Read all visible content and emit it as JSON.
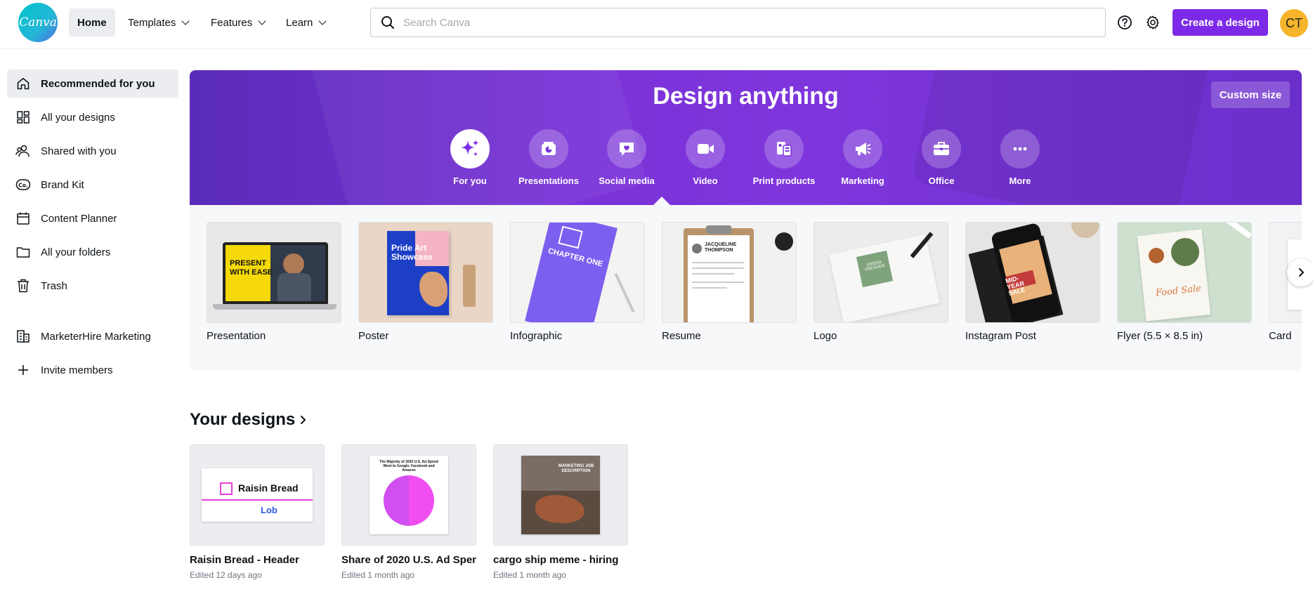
{
  "app": {
    "logo_text": "Canva",
    "avatar_initials": "CT",
    "accent_color": "#7d2ae8"
  },
  "topnav": {
    "items": [
      {
        "label": "Home"
      },
      {
        "label": "Templates"
      },
      {
        "label": "Features"
      },
      {
        "label": "Learn"
      }
    ],
    "search_placeholder": "Search Canva",
    "create_label": "Create a design"
  },
  "sidebar": {
    "items": [
      {
        "label": "Recommended for you",
        "icon": "home-icon"
      },
      {
        "label": "All your designs",
        "icon": "grid-icon"
      },
      {
        "label": "Shared with you",
        "icon": "people-icon"
      },
      {
        "label": "Brand Kit",
        "icon": "brand-kit-icon"
      },
      {
        "label": "Content Planner",
        "icon": "calendar-icon"
      },
      {
        "label": "All your folders",
        "icon": "folder-icon"
      },
      {
        "label": "Trash",
        "icon": "trash-icon"
      }
    ],
    "team": {
      "label": "MarketerHire Marketing",
      "icon": "building-icon"
    },
    "invite": {
      "label": "Invite members",
      "icon": "plus-icon"
    }
  },
  "hero": {
    "title": "Design anything",
    "custom_size_label": "Custom size",
    "categories": [
      {
        "label": "For you",
        "icon": "sparkle-icon"
      },
      {
        "label": "Presentations",
        "icon": "presentation-icon"
      },
      {
        "label": "Social media",
        "icon": "heart-chat-icon"
      },
      {
        "label": "Video",
        "icon": "video-icon"
      },
      {
        "label": "Print products",
        "icon": "print-icon"
      },
      {
        "label": "Marketing",
        "icon": "megaphone-icon"
      },
      {
        "label": "Office",
        "icon": "briefcase-icon"
      },
      {
        "label": "More",
        "icon": "more-icon"
      }
    ]
  },
  "templates": [
    {
      "label": "Presentation",
      "thumb_text": "PRESENT WITH EASE"
    },
    {
      "label": "Poster",
      "thumb_text": "Pride Art Showcase"
    },
    {
      "label": "Infographic",
      "thumb_text": "CHAPTER ONE"
    },
    {
      "label": "Resume",
      "thumb_text": "JACQUELINE THOMPSON"
    },
    {
      "label": "Logo",
      "thumb_text": "GREEN FRESHER"
    },
    {
      "label": "Instagram Post",
      "thumb_text": "MID-YEAR SALE"
    },
    {
      "label": "Flyer (5.5 × 8.5 in)",
      "thumb_text": "Food Sale"
    },
    {
      "label": "Card",
      "thumb_text": ""
    }
  ],
  "your_designs": {
    "title": "Your designs",
    "items": [
      {
        "name": "Raisin Bread - Header",
        "edited": "Edited 12 days ago",
        "thumb_title": "Raisin Bread",
        "thumb_sub": "Lob"
      },
      {
        "name": "Share of 2020 U.S. Ad Spen...",
        "edited": "Edited 1 month ago",
        "thumb_title": "The Majority of 2020 U.S. Ad Spend Went to Google, Facebook and Amazon"
      },
      {
        "name": "cargo ship meme - hiring",
        "edited": "Edited 1 month ago",
        "thumb_title": "MARKETING JOB DESCRIPTION"
      }
    ]
  }
}
